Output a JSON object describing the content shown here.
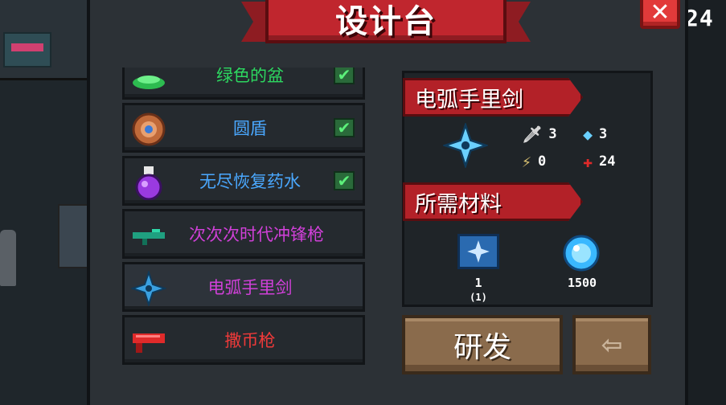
{
  "hud": {
    "corner_number": "24"
  },
  "header": {
    "title": "设计台",
    "close_label": "✕"
  },
  "blueprint_list": [
    {
      "name": "绿色的盆",
      "icon": "green-basin-icon",
      "color": "#2dd760",
      "unlocked": true
    },
    {
      "name": "圆盾",
      "icon": "round-shield-icon",
      "color": "#4aa8ff",
      "unlocked": true
    },
    {
      "name": "无尽恢复药水",
      "icon": "purple-potion-icon",
      "color": "#4aa8ff",
      "unlocked": true
    },
    {
      "name": "次次次时代冲锋枪",
      "icon": "green-smg-icon",
      "color": "#d040d8",
      "unlocked": false
    },
    {
      "name": "电弧手里剑",
      "icon": "shuriken-icon",
      "color": "#d040d8",
      "unlocked": false,
      "selected": true
    },
    {
      "name": "撒币枪",
      "icon": "red-coin-gun-icon",
      "color": "#f03a3a",
      "unlocked": false
    }
  ],
  "detail": {
    "item_name": "电弧手里剑",
    "stats": {
      "damage": "3",
      "energy": "3",
      "crit": "0",
      "accuracy": "24"
    },
    "materials_title": "所需材料",
    "materials": [
      {
        "icon": "shuriken-blueprint-icon",
        "count": "1",
        "sub": "(1)"
      },
      {
        "icon": "blue-gem-icon",
        "count": "1500"
      }
    ]
  },
  "actions": {
    "research_label": "研发",
    "exit_label": "⇦"
  },
  "colors": {
    "ribbon_red": "#c0262e",
    "check_green": "#5cf07a",
    "button_brown": "#8a6b4c"
  }
}
